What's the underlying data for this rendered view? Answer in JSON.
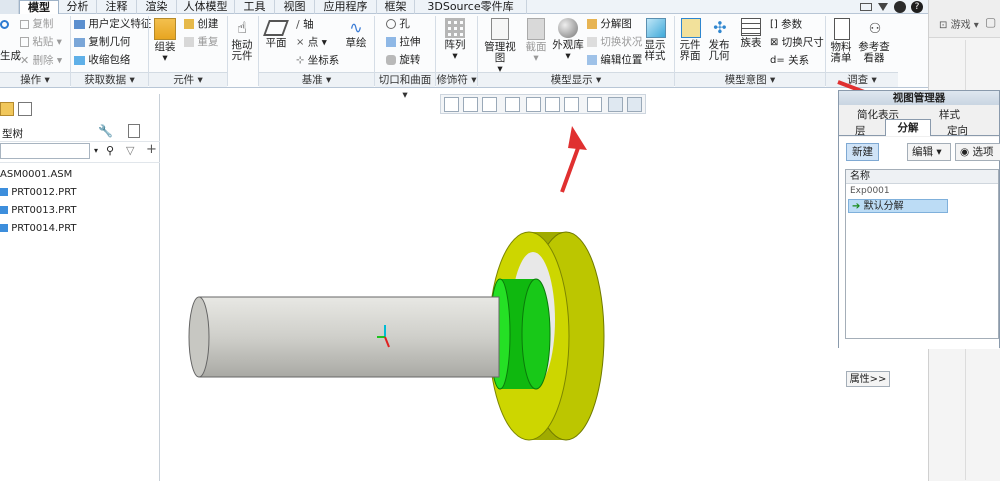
{
  "tabs": [
    {
      "label": "模型",
      "active": true
    },
    {
      "label": "分析"
    },
    {
      "label": "注释"
    },
    {
      "label": "渲染"
    },
    {
      "label": "人体模型"
    },
    {
      "label": "工具"
    },
    {
      "label": "视图"
    },
    {
      "label": "应用程序"
    },
    {
      "label": "框架"
    },
    {
      "label": "3DSource零件库"
    }
  ],
  "ribbon": {
    "operations": {
      "regenerate": "生成",
      "copy": "复制",
      "paste": "粘贴",
      "delete": "删除",
      "label": "操作"
    },
    "getdata": {
      "udf": "用户定义特征",
      "copy_geom": "复制几何",
      "shrinkwrap": "收缩包络",
      "label": "获取数据"
    },
    "component": {
      "assemble": "组装",
      "create": "创建",
      "repeat": "重复",
      "label": "元件"
    },
    "drag": "拖动元件",
    "datum": {
      "plane": "平面",
      "axis": "轴",
      "point": "点",
      "csys": "坐标系",
      "sketch": "草绘",
      "label": "基准"
    },
    "cut": {
      "hole": "孔",
      "extrude": "拉伸",
      "revolve": "旋转",
      "label": "切口和曲面"
    },
    "modifiers": {
      "pattern": "阵列",
      "label": "修饰符"
    },
    "display": {
      "manage_views": "管理视图",
      "section": "截面",
      "appearance": "外观库",
      "explode": "分解图",
      "toggle_state": "切换状况",
      "edit_position": "编辑位置",
      "display_style": "显示样式",
      "label": "模型显示"
    },
    "intent": {
      "component_interface": "元件界面",
      "publish_geom": "发布几何",
      "family_table": "族表",
      "parameters": "参数",
      "switch_dim": "切换尺寸",
      "relations": "关系",
      "label": "模型意图"
    },
    "investigate": {
      "bom": "物料清单",
      "ref_viewer": "参考查看器",
      "label": "调查"
    }
  },
  "right_strip": {
    "game": "游戏"
  },
  "tree": {
    "title": "型树",
    "items": [
      "ASM0001.ASM",
      "PRT0012.PRT",
      "PRT0013.PRT",
      "PRT0014.PRT"
    ]
  },
  "view_manager": {
    "title": "视图管理器",
    "tabs_top": [
      "简化表示",
      "样式",
      ""
    ],
    "tabs_bottom": [
      "层",
      "分解",
      "定向",
      ""
    ],
    "active_tab": "分解",
    "new_btn": "新建",
    "edit_btn": "编辑",
    "options_btn": "选项",
    "col_name": "名称",
    "rows": [
      "Exp0001",
      "默认分解"
    ],
    "properties": "属性>>"
  },
  "colors": {
    "accent": "#2f6fb3",
    "arrow": "#e03030",
    "shaft": "#d4d4d0",
    "ring_green": "#14d414",
    "flange": "#c8d400"
  }
}
